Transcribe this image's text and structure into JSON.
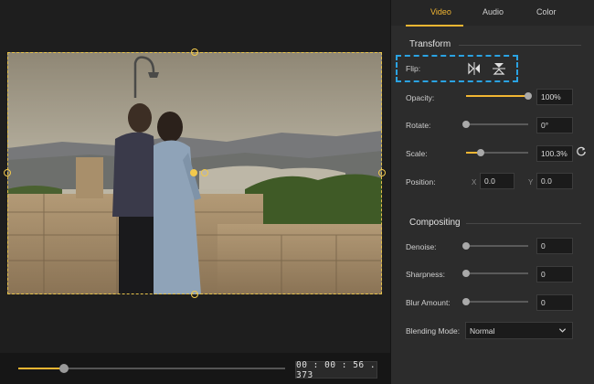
{
  "tabs": [
    {
      "label": "Video",
      "active": true
    },
    {
      "label": "Audio",
      "active": false
    },
    {
      "label": "Color",
      "active": false
    }
  ],
  "transform": {
    "title": "Transform",
    "flip_label": "Flip:",
    "flip_icons": [
      "flip-horizontal-icon",
      "flip-vertical-icon"
    ],
    "opacity": {
      "label": "Opacity:",
      "value": "100%",
      "level": 1.0
    },
    "rotate": {
      "label": "Rotate:",
      "value": "0°",
      "level": 0.0
    },
    "scale": {
      "label": "Scale:",
      "value": "100.3%",
      "level": 0.24
    },
    "position": {
      "label": "Position:",
      "x_label": "X",
      "x_value": "0.0",
      "y_label": "Y",
      "y_value": "0.0"
    }
  },
  "compositing": {
    "title": "Compositing",
    "denoise": {
      "label": "Denoise:",
      "value": "0",
      "level": 0.0
    },
    "sharpness": {
      "label": "Sharpness:",
      "value": "0",
      "level": 0.0
    },
    "blur_amount": {
      "label": "Blur Amount:",
      "value": "0",
      "level": 0.0
    },
    "blending_mode": {
      "label": "Blending Mode:",
      "selected": "Normal"
    }
  },
  "player": {
    "timecode": "00 : 00 : 56 . 373",
    "progress": 0.17
  },
  "colors": {
    "accent": "#f2b632",
    "highlight": "#2aa3e3",
    "panel_bg": "#2c2c2c"
  },
  "icons": {
    "reset": "reset-icon",
    "dropdown": "chevron-down-icon"
  }
}
